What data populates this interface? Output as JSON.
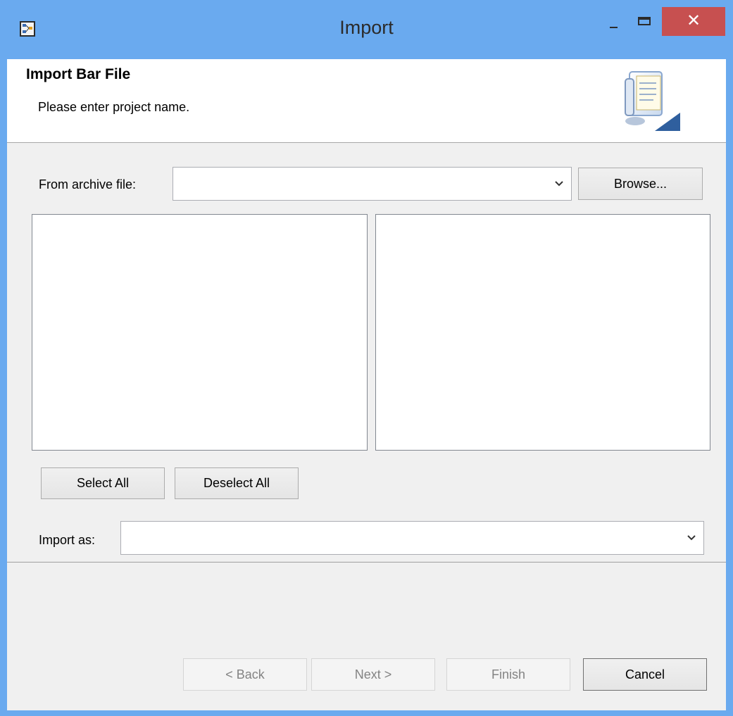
{
  "window": {
    "title": "Import",
    "close_symbol": "✕"
  },
  "banner": {
    "title": "Import Bar File",
    "message": "Please enter project name."
  },
  "archive": {
    "label": "From archive file:",
    "value": "",
    "browse_label": "Browse..."
  },
  "selection": {
    "select_all_label": "Select All",
    "deselect_all_label": "Deselect All"
  },
  "import_as": {
    "label": "Import as:",
    "value": ""
  },
  "footer": {
    "back_label": "< Back",
    "next_label": "Next >",
    "finish_label": "Finish",
    "cancel_label": "Cancel"
  },
  "icons": {
    "app": "hierarchy-icon",
    "banner": "import-archive-icon",
    "dropdown": "chevron-down-icon"
  },
  "colors": {
    "titlebar": "#6aaaef",
    "close": "#c75050",
    "dialog_bg": "#f0f0f0"
  }
}
